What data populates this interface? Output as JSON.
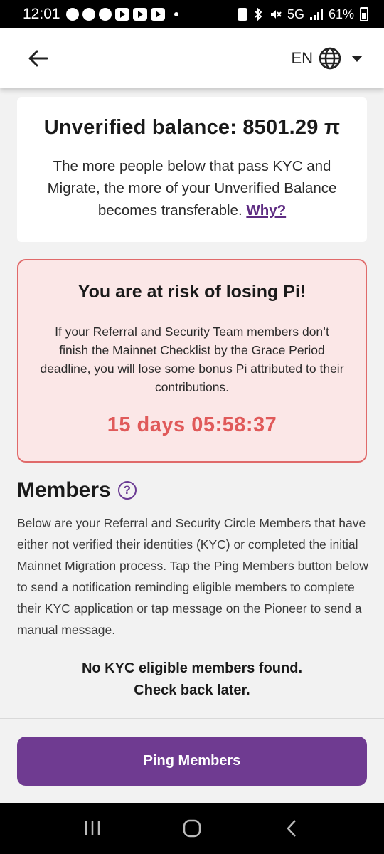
{
  "status_bar": {
    "time": "12:01",
    "network": "5G",
    "battery": "61%"
  },
  "header": {
    "language": "EN"
  },
  "balance": {
    "title": "Unverified balance: 8501.29 π",
    "description": "The more people below that pass KYC and Migrate, the more of your Unverified Balance becomes transferable.",
    "why_link": "Why?"
  },
  "risk": {
    "title": "You are at risk of losing Pi!",
    "description": "If your Referral and Security Team members don’t finish the Mainnet Checklist by the Grace Period deadline, you will lose some bonus Pi attributed to their contributions.",
    "countdown": "15 days 05:58:37"
  },
  "members": {
    "title": "Members",
    "help_icon": "?",
    "description": "Below are your Referral and Security Circle Members that have either not verified their identities (KYC) or completed the initial Mainnet Migration process. Tap the Ping Members button below to send a notification reminding eligible members to complete their KYC application or tap message on the Pioneer to send a manual message.",
    "empty_line1": "No KYC eligible members found.",
    "empty_line2": "Check back later."
  },
  "actions": {
    "ping_button": "Ping Members"
  },
  "colors": {
    "brand_purple": "#6f3b91",
    "risk_red": "#e05a5a",
    "risk_bg": "#fbe7e7"
  }
}
